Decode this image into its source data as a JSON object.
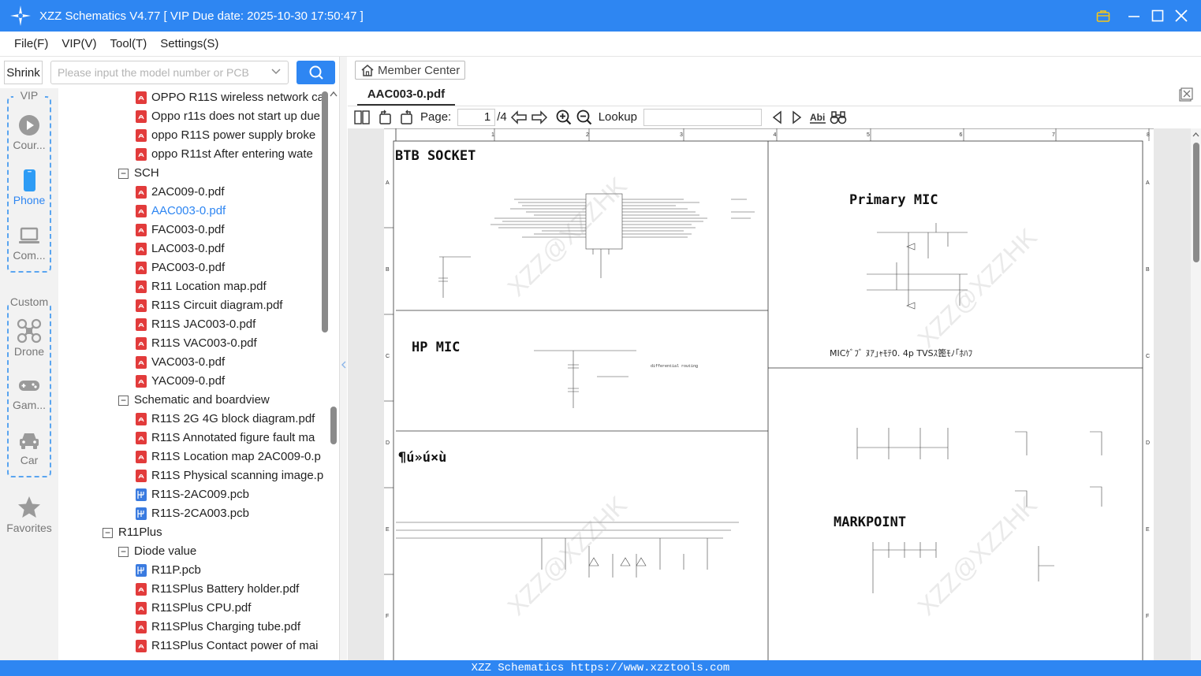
{
  "titlebar": {
    "title": "XZZ Schematics V4.77 [ VIP Due date: 2025-10-30 17:50:47 ]"
  },
  "menu": [
    "File(F)",
    "VIP(V)",
    "Tool(T)",
    "Settings(S)"
  ],
  "search": {
    "shrink_label": "Shrink",
    "placeholder": "Please input the model number or PCB"
  },
  "rail": {
    "vip_label": "VIP",
    "custom_label": "Custom",
    "items": [
      "Cour...",
      "Phone",
      "Com...",
      "Drone",
      "Gam...",
      "Car",
      "Favorites"
    ]
  },
  "tree": [
    {
      "kind": "pdf",
      "label": "OPPO R11S wireless network ca"
    },
    {
      "kind": "pdf",
      "label": "Oppo r11s does not start up due"
    },
    {
      "kind": "pdf",
      "label": "oppo R11S power supply broke"
    },
    {
      "kind": "pdf",
      "label": "oppo R11st After entering wate"
    },
    {
      "kind": "folder",
      "label": "SCH"
    },
    {
      "kind": "pdf",
      "label": "2AC009-0.pdf"
    },
    {
      "kind": "pdf",
      "label": "AAC003-0.pdf",
      "selected": true
    },
    {
      "kind": "pdf",
      "label": "FAC003-0.pdf"
    },
    {
      "kind": "pdf",
      "label": "LAC003-0.pdf"
    },
    {
      "kind": "pdf",
      "label": "PAC003-0.pdf"
    },
    {
      "kind": "pdf",
      "label": "R11 Location map.pdf"
    },
    {
      "kind": "pdf",
      "label": "R11S Circuit diagram.pdf"
    },
    {
      "kind": "pdf",
      "label": "R11S JAC003-0.pdf"
    },
    {
      "kind": "pdf",
      "label": "R11S VAC003-0.pdf"
    },
    {
      "kind": "pdf",
      "label": "VAC003-0.pdf"
    },
    {
      "kind": "pdf",
      "label": "YAC009-0.pdf"
    },
    {
      "kind": "folder",
      "label": "Schematic and boardview"
    },
    {
      "kind": "pdf",
      "label": "R11S 2G 4G block diagram.pdf"
    },
    {
      "kind": "pdf",
      "label": "R11S Annotated figure fault ma"
    },
    {
      "kind": "pdf",
      "label": "R11S Location map 2AC009-0.p"
    },
    {
      "kind": "pdf",
      "label": "R11S Physical scanning image.p"
    },
    {
      "kind": "pcb",
      "label": "R11S-2AC009.pcb"
    },
    {
      "kind": "pcb",
      "label": "R11S-2CA003.pcb"
    },
    {
      "kind": "model",
      "label": "R11Plus"
    },
    {
      "kind": "folder",
      "label": "Diode value"
    },
    {
      "kind": "pcb",
      "label": "R11P.pcb"
    },
    {
      "kind": "pdf",
      "label": "R11SPlus Battery holder.pdf"
    },
    {
      "kind": "pdf",
      "label": "R11SPlus CPU.pdf"
    },
    {
      "kind": "pdf",
      "label": "R11SPlus Charging tube.pdf"
    },
    {
      "kind": "pdf",
      "label": "R11SPlus Contact power of mai"
    }
  ],
  "viewer": {
    "member_center": "Member Center",
    "tab_name": "AAC003-0.pdf",
    "page_label": "Page:",
    "page_current": "1",
    "page_total": "/4",
    "lookup_label": "Lookup"
  },
  "schematic": {
    "col_numbers": [
      "1",
      "2",
      "3",
      "4",
      "5",
      "6",
      "7",
      "8"
    ],
    "row_letters": [
      "A",
      "B",
      "C",
      "D",
      "E",
      "F"
    ],
    "sections": [
      "BTB SOCKET",
      "Primary MIC",
      "HP MIC",
      "¶ú»ú×ù",
      "MARKPOINT"
    ],
    "mic_note": "MICｹﾞﾌﾞ ﾇｱ｣ｬﾓﾃ0. 4p TVSｽ篦ﾓﾉ｢ﾎﾊﾌ",
    "diff_note": "differential routing",
    "watermark": "XZZ@XZZHK"
  },
  "footer": {
    "text": "XZZ Schematics https://www.xzztools.com"
  }
}
